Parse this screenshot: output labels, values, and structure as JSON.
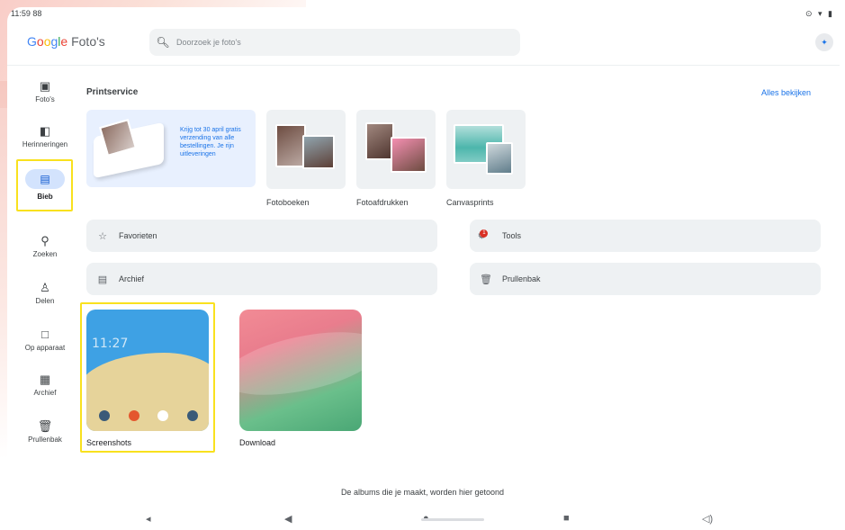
{
  "status": {
    "time": "11:59 88",
    "icons": "⊙ ▾ ▮"
  },
  "app": {
    "brand": "Google",
    "brand_suffix": " Foto's"
  },
  "search": {
    "placeholder": "Doorzoek je foto's"
  },
  "nav": {
    "items": [
      {
        "label": "Foto's",
        "icon": "photo-icon"
      },
      {
        "label": "Herinneringen",
        "icon": "memories-icon"
      },
      {
        "label": "Bieb",
        "icon": "library-icon",
        "active": true
      },
      {
        "label": "Zoeken",
        "icon": "search-icon"
      },
      {
        "label": "Delen",
        "icon": "share-icon"
      },
      {
        "label": "Op apparaat",
        "icon": "folder-icon"
      },
      {
        "label": "Archief",
        "icon": "archive-icon"
      },
      {
        "label": "Prullenbak",
        "icon": "trash-icon"
      }
    ]
  },
  "printservice": {
    "title": "Printservice",
    "see_all": "Alles bekijken",
    "promo_text": "Krijg tot 30 april gratis verzending van alle bestellingen. Je rijn uitleveringen",
    "products": [
      {
        "label": "Fotoboeken"
      },
      {
        "label": "Fotoafdrukken"
      },
      {
        "label": "Canvasprints"
      }
    ]
  },
  "quick": {
    "favorieten": "Favorieten",
    "tools": "Tools",
    "tools_badge": "1",
    "archief": "Archief",
    "prullenbak": "Prullenbak"
  },
  "albums": [
    {
      "label": "Screenshots",
      "clock": "11:27"
    },
    {
      "label": "Download"
    }
  ],
  "footer": {
    "note": "De albums die je maakt, worden hier getoond"
  },
  "colors": {
    "accent": "#1a73e8",
    "highlight": "#f9e11e"
  }
}
